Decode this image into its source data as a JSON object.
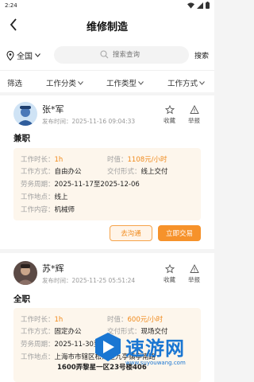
{
  "status_bar": {
    "time": "2:24"
  },
  "header": {
    "title": "维修制造"
  },
  "search": {
    "location": "全国",
    "placeholder": "搜索查询",
    "button": "搜索"
  },
  "filters": [
    {
      "label": "筛选"
    },
    {
      "label": "工作分类"
    },
    {
      "label": "工作类型"
    },
    {
      "label": "工作方式"
    }
  ],
  "actions": {
    "favorite": "收藏",
    "report": "举报"
  },
  "jobs": [
    {
      "name": "张*军",
      "published": "发布时间：2025-11-16 09:04:33",
      "type": "兼职",
      "fields": {
        "duration_label": "工作时长：",
        "duration": "1h",
        "wage_label": "时值：",
        "wage": "1108元/小时",
        "mode_label": "工作方式：",
        "mode": "自由办公",
        "delivery_label": "交付形式：",
        "delivery": "线上交付",
        "period_label": "劳务周期：",
        "period": "2025-11-17至2025-12-06",
        "place_label": "工作地点：",
        "place": "线上",
        "content_label": "工作内容：",
        "content": "机械师"
      },
      "buttons": {
        "chat": "去沟通",
        "deal": "立即交易"
      }
    },
    {
      "name": "苏*辉",
      "published": "发布时间：2025-11-25 05:51:24",
      "type": "全职",
      "fields": {
        "duration_label": "工作时长：",
        "duration": "1h",
        "wage_label": "时值：",
        "wage": "600元/小时",
        "mode_label": "工作方式：",
        "mode": "固定办公",
        "delivery_label": "交付形式：",
        "delivery": "现场交付",
        "period_label": "劳务周期：",
        "period": "2025-11-30至2026-",
        "place_label": "工作地点：",
        "place": "上海市市辖区松江区九亭镇亭南路",
        "place2": "1600弄黎星一区23号楼406"
      }
    }
  ],
  "watermark": {
    "text": "速游网",
    "sub": "www.suyouwang.com"
  },
  "colors": {
    "accent": "#f6922b",
    "accent_text": "#f08a1c",
    "info_bg": "#fdf6ec"
  }
}
